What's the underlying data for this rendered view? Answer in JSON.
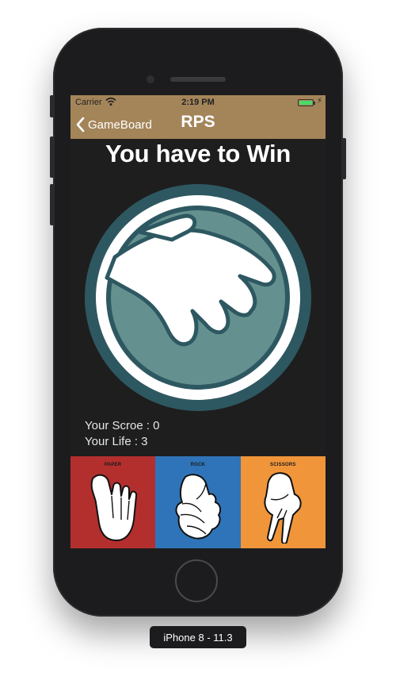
{
  "status_bar": {
    "carrier": "Carrier",
    "time": "2:19 PM",
    "battery_level": 1.0
  },
  "nav": {
    "back_label": "GameBoard",
    "title": "RPS"
  },
  "game": {
    "instruction": "You have to Win",
    "score_text": "Your Scroe : 0",
    "life_text": "Your Life : 3",
    "display_hand": "paper-hand-icon"
  },
  "choices": [
    {
      "label": "PAPER",
      "color": "#b32f2e",
      "icon": "paper-hand-icon"
    },
    {
      "label": "ROCK",
      "color": "#2f74b8",
      "icon": "rock-fist-icon"
    },
    {
      "label": "SCISSORS",
      "color": "#f0953a",
      "icon": "scissors-hand-icon"
    }
  ],
  "simulator": {
    "device_label": "iPhone 8 - 11.3"
  }
}
